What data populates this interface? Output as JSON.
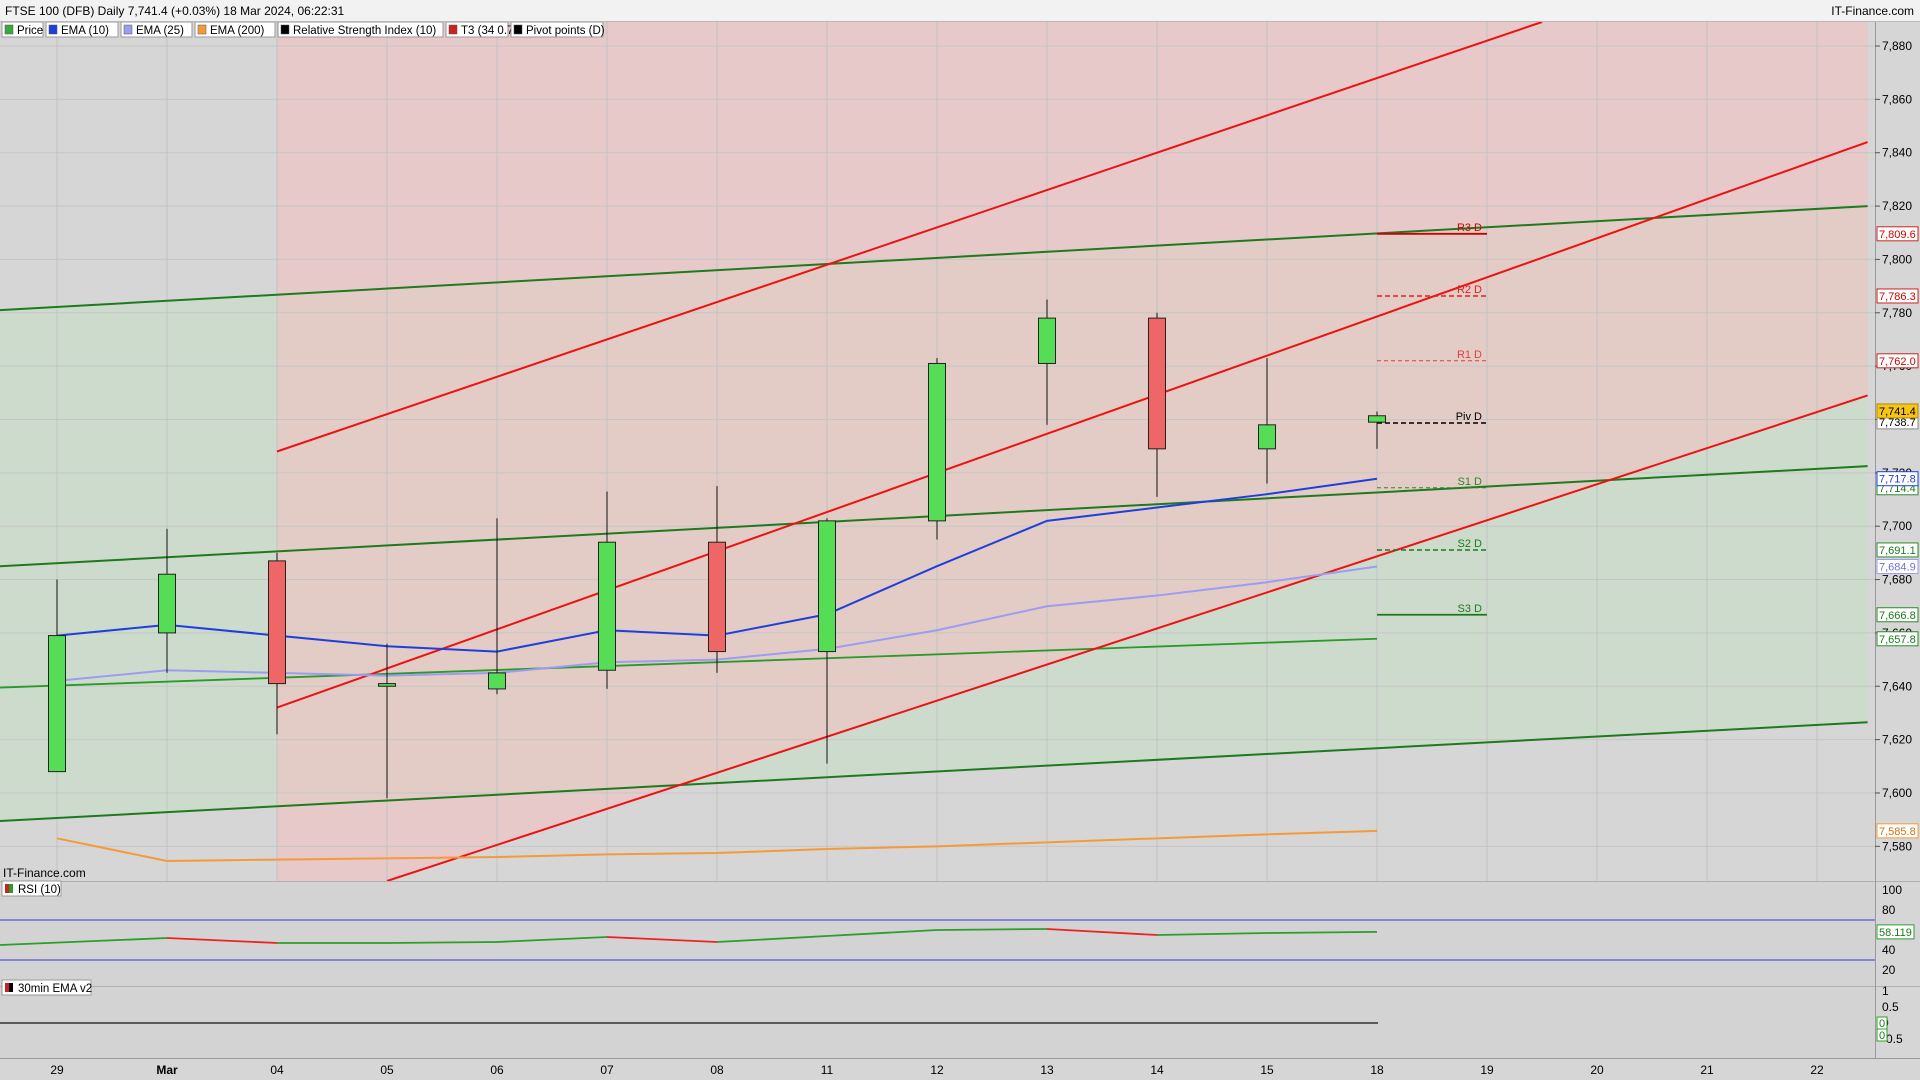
{
  "header": {
    "title": "FTSE 100 (DFB) Daily 7,741.4 (+0.03%) 18 Mar 2024, 06:22:31",
    "brand": "IT-Finance.com"
  },
  "legend": [
    {
      "label": "Price",
      "color": "#3aa83a"
    },
    {
      "label": "EMA (10)",
      "color": "#1f3fdd"
    },
    {
      "label": "EMA (25)",
      "color": "#9b9cf2"
    },
    {
      "label": "EMA (200)",
      "color": "#f59a3a"
    },
    {
      "label": "Relative Strength Index (10)",
      "color": "#000000"
    },
    {
      "label": "T3 (34 0.7)",
      "color": "#cc2222"
    },
    {
      "label": "Pivot points (D)",
      "color": "#000000"
    }
  ],
  "watermark": "IT-Finance.com",
  "rsi_panel": {
    "label": "RSI (10)",
    "value_label": "58.119",
    "ticks": [
      "100",
      "80",
      "60",
      "40",
      "20"
    ]
  },
  "ema_panel": {
    "label": "30min EMA v2",
    "ticks": [
      "1",
      "0.5",
      "0",
      "-0.5"
    ],
    "value_labels": [
      "0",
      "0"
    ]
  },
  "chart_data": {
    "type": "candlestick",
    "title": "FTSE 100 (DFB) Daily 7,741.4 (+0.03%) 18 Mar 2024, 06:22:31",
    "x_labels": [
      "29",
      "Mar",
      "04",
      "05",
      "06",
      "07",
      "08",
      "11",
      "12",
      "13",
      "14",
      "15",
      "18",
      "19",
      "20",
      "21",
      "22"
    ],
    "y_ticks": [
      7580,
      7600,
      7620,
      7640,
      7660,
      7680,
      7700,
      7720,
      7740,
      7760,
      7780,
      7800,
      7820,
      7840,
      7860,
      7880
    ],
    "y_tick_labels": [
      "7,580",
      "7,600",
      "7,620",
      "7,640",
      "7,660",
      "7,680",
      "7,700",
      "7,720",
      "7,740",
      "7,760",
      "7,780",
      "7,800",
      "7,820",
      "7,840",
      "7,860",
      "7,880"
    ],
    "y_range": [
      7567,
      7889
    ],
    "candles": [
      {
        "date": "29",
        "open": 7608,
        "high": 7680,
        "low": 7608,
        "close": 7659
      },
      {
        "date": "Mar",
        "open": 7660,
        "high": 7699,
        "low": 7645,
        "close": 7682
      },
      {
        "date": "04",
        "open": 7687,
        "high": 7690,
        "low": 7622,
        "close": 7641
      },
      {
        "date": "05",
        "open": 7640,
        "high": 7656,
        "low": 7598,
        "close": 7641
      },
      {
        "date": "06",
        "open": 7639,
        "high": 7703,
        "low": 7637,
        "close": 7645
      },
      {
        "date": "07",
        "open": 7646,
        "high": 7713,
        "low": 7639,
        "close": 7694
      },
      {
        "date": "08",
        "open": 7694,
        "high": 7715,
        "low": 7645,
        "close": 7653
      },
      {
        "date": "11",
        "open": 7653,
        "high": 7703,
        "low": 7611,
        "close": 7702
      },
      {
        "date": "12",
        "open": 7702,
        "high": 7763,
        "low": 7695,
        "close": 7761
      },
      {
        "date": "13",
        "open": 7761,
        "high": 7785,
        "low": 7738,
        "close": 7778
      },
      {
        "date": "14",
        "open": 7778,
        "high": 7780,
        "low": 7711,
        "close": 7729
      },
      {
        "date": "15",
        "open": 7729,
        "high": 7763,
        "low": 7716,
        "close": 7738
      },
      {
        "date": "18",
        "open": 7739,
        "high": 7743,
        "low": 7729,
        "close": 7741.4
      }
    ],
    "ema10": [
      7659,
      7663,
      7659,
      7655,
      7653,
      7661,
      7659,
      7667,
      7685,
      7702,
      7707,
      7712,
      7717.8
    ],
    "ema25": [
      7642,
      7646,
      7645,
      7644,
      7645,
      7649,
      7650,
      7654,
      7661,
      7670,
      7674,
      7679,
      7684.9
    ],
    "ema200": [
      7583,
      7574.5,
      7575,
      7575.5,
      7576,
      7577,
      7577.5,
      7579,
      7580,
      7581.5,
      7583,
      7584.5,
      7585.8
    ],
    "pivots": [
      {
        "label": "R3 D",
        "value": 7809.6,
        "value_label": "7,809.6",
        "color": "#cc0000",
        "style": "solid"
      },
      {
        "label": "R2 D",
        "value": 7786.3,
        "value_label": "7,786.3",
        "color": "#e02020",
        "style": "dash"
      },
      {
        "label": "R1 D",
        "value": 7762.0,
        "value_label": "7,762.0",
        "color": "#e04040",
        "style": "dash-thin"
      },
      {
        "label": "Piv D",
        "value": 7738.7,
        "value_label": "7,738.7",
        "color": "#000000",
        "style": "dash"
      },
      {
        "label": "S1 D",
        "value": 7714.4,
        "value_label": "7,714.4",
        "color": "#2a8a2a",
        "style": "dash-thin"
      },
      {
        "label": "S2 D",
        "value": 7691.1,
        "value_label": "7,691.1",
        "color": "#1a7a1a",
        "style": "dash"
      },
      {
        "label": "S3 D",
        "value": 7666.8,
        "value_label": "7,666.8",
        "color": "#1a7a1a",
        "style": "solid"
      }
    ],
    "last_price_label": "7,741.4",
    "ema10_label": "7,717.8",
    "ema25_label": "7,684.9",
    "ema200_label": "7,585.8",
    "green_channel_label": "7,657.8",
    "green_channel": {
      "start_x_index": -0.52,
      "end_x_index": 16.46,
      "upper": [
        7781,
        7820
      ],
      "middle": [
        7685,
        7722.5
      ],
      "lower": [
        7589.5,
        7626.5
      ],
      "inner_line": {
        "end_x_index": 12,
        "values": [
          7639.5,
          7657.8
        ]
      }
    },
    "red_channel": {
      "start_x_index": 2,
      "upper": [
        7728,
        7889
      ],
      "upper_end_x_index": 13.5,
      "middle": [
        7632,
        7844
      ],
      "lower": [
        7567,
        7749
      ],
      "middle_lower_end_x_index": 16.46,
      "lower_start_x_index": 3
    },
    "rsi": {
      "range": [
        0,
        100
      ],
      "levels": [
        30,
        70
      ],
      "values": [
        45,
        52,
        47,
        47,
        48,
        53,
        48,
        54,
        60,
        61,
        55,
        57,
        58.119
      ]
    }
  }
}
